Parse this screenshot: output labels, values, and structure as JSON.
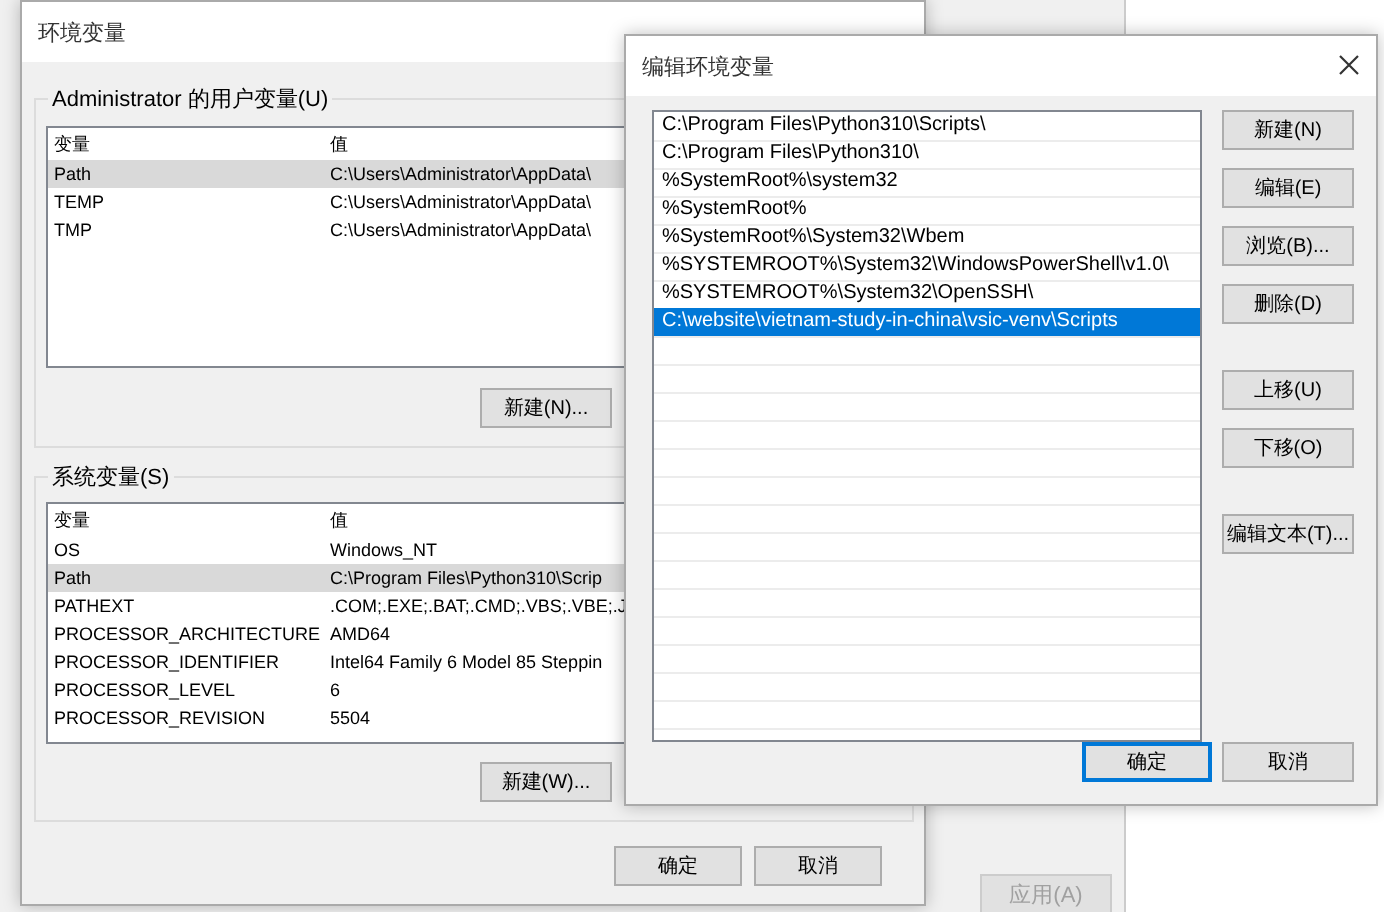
{
  "background_window": {
    "apply_button": {
      "label": "应用(A)",
      "disabled": true
    }
  },
  "env_window": {
    "title": "环境变量",
    "user_group": {
      "title": "Administrator 的用户变量(U)",
      "columns": [
        "变量",
        "值"
      ],
      "rows": [
        {
          "name": "Path",
          "value": "C:\\Users\\Administrator\\AppData\\",
          "selected": true
        },
        {
          "name": "TEMP",
          "value": "C:\\Users\\Administrator\\AppData\\",
          "selected": false
        },
        {
          "name": "TMP",
          "value": "C:\\Users\\Administrator\\AppData\\",
          "selected": false
        }
      ],
      "new_button": "新建(N)..."
    },
    "system_group": {
      "title": "系统变量(S)",
      "columns": [
        "变量",
        "值"
      ],
      "rows": [
        {
          "name": "OS",
          "value": "Windows_NT",
          "selected": false
        },
        {
          "name": "Path",
          "value": "C:\\Program Files\\Python310\\Scrip",
          "selected": true
        },
        {
          "name": "PATHEXT",
          "value": ".COM;.EXE;.BAT;.CMD;.VBS;.VBE;.J",
          "selected": false
        },
        {
          "name": "PROCESSOR_ARCHITECTURE",
          "value": "AMD64",
          "selected": false
        },
        {
          "name": "PROCESSOR_IDENTIFIER",
          "value": "Intel64 Family 6 Model 85 Steppin",
          "selected": false
        },
        {
          "name": "PROCESSOR_LEVEL",
          "value": "6",
          "selected": false
        },
        {
          "name": "PROCESSOR_REVISION",
          "value": "5504",
          "selected": false
        }
      ],
      "new_button": "新建(W)..."
    },
    "buttons": [
      "确定",
      "取消"
    ]
  },
  "edit_dialog": {
    "title": "编辑环境变量",
    "entries": [
      {
        "text": "C:\\Program Files\\Python310\\Scripts\\",
        "selected": false
      },
      {
        "text": "C:\\Program Files\\Python310\\",
        "selected": false
      },
      {
        "text": "%SystemRoot%\\system32",
        "selected": false
      },
      {
        "text": "%SystemRoot%",
        "selected": false
      },
      {
        "text": "%SystemRoot%\\System32\\Wbem",
        "selected": false
      },
      {
        "text": "%SYSTEMROOT%\\System32\\WindowsPowerShell\\v1.0\\",
        "selected": false
      },
      {
        "text": "%SYSTEMROOT%\\System32\\OpenSSH\\",
        "selected": false
      },
      {
        "text": "C:\\website\\vietnam-study-in-china\\vsic-venv\\Scripts",
        "selected": true
      }
    ],
    "side_buttons": [
      "新建(N)",
      "编辑(E)",
      "浏览(B)...",
      "删除(D)",
      "上移(U)",
      "下移(O)",
      "编辑文本(T)..."
    ],
    "ok_button": {
      "label": "确定",
      "default": true
    },
    "cancel_button": "取消"
  }
}
